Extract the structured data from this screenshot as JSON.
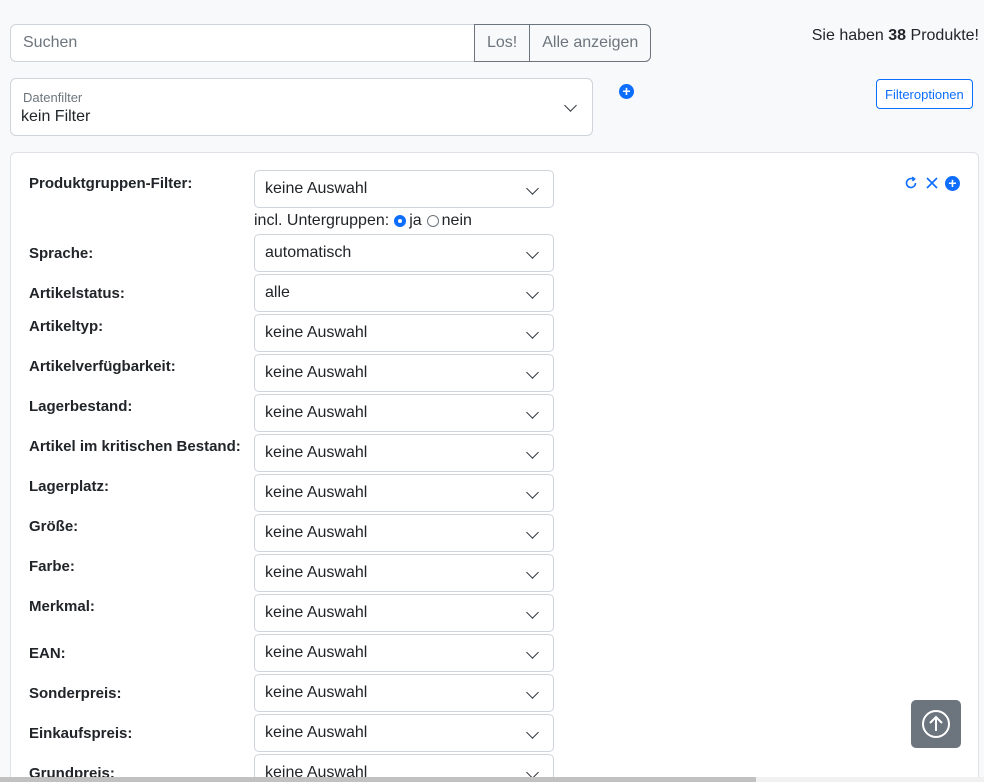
{
  "search": {
    "placeholder": "Suchen",
    "go_label": "Los!",
    "show_all_label": "Alle anzeigen"
  },
  "product_count": {
    "prefix": "Sie haben",
    "count": "38",
    "suffix": "Produkte!"
  },
  "datefilter": {
    "label": "Datenfilter",
    "value": "kein Filter"
  },
  "filteroptions_label": "Filteroptionen",
  "subgroups": {
    "label": "incl. Untergruppen:",
    "yes": "ja",
    "no": "nein",
    "selected": "ja"
  },
  "filters": [
    {
      "label": "Produktgruppen-Filter:",
      "value": "keine Auswahl"
    },
    {
      "label": "Sprache:",
      "value": "automatisch"
    },
    {
      "label": "Artikelstatus:",
      "value": "alle"
    },
    {
      "label": "Artikeltyp:",
      "value": "keine Auswahl"
    },
    {
      "label": "Artikelverfügbarkeit:",
      "value": "keine Auswahl"
    },
    {
      "label": "Lagerbestand:",
      "value": "keine Auswahl"
    },
    {
      "label": "Artikel im kritischen Bestand:",
      "value": "keine Auswahl"
    },
    {
      "label": "Lagerplatz:",
      "value": "keine Auswahl"
    },
    {
      "label": "Größe:",
      "value": "keine Auswahl"
    },
    {
      "label": "Farbe:",
      "value": "keine Auswahl"
    },
    {
      "label": "Merkmal:",
      "value": "keine Auswahl"
    },
    {
      "label": "EAN:",
      "value": "keine Auswahl"
    },
    {
      "label": "Sonderpreis:",
      "value": "keine Auswahl"
    },
    {
      "label": "Einkaufspreis:",
      "value": "keine Auswahl"
    },
    {
      "label": "Grundpreis:",
      "value": "keine Auswahl"
    }
  ],
  "colors": {
    "primary": "#0d6efd",
    "secondary": "#6c757d"
  }
}
